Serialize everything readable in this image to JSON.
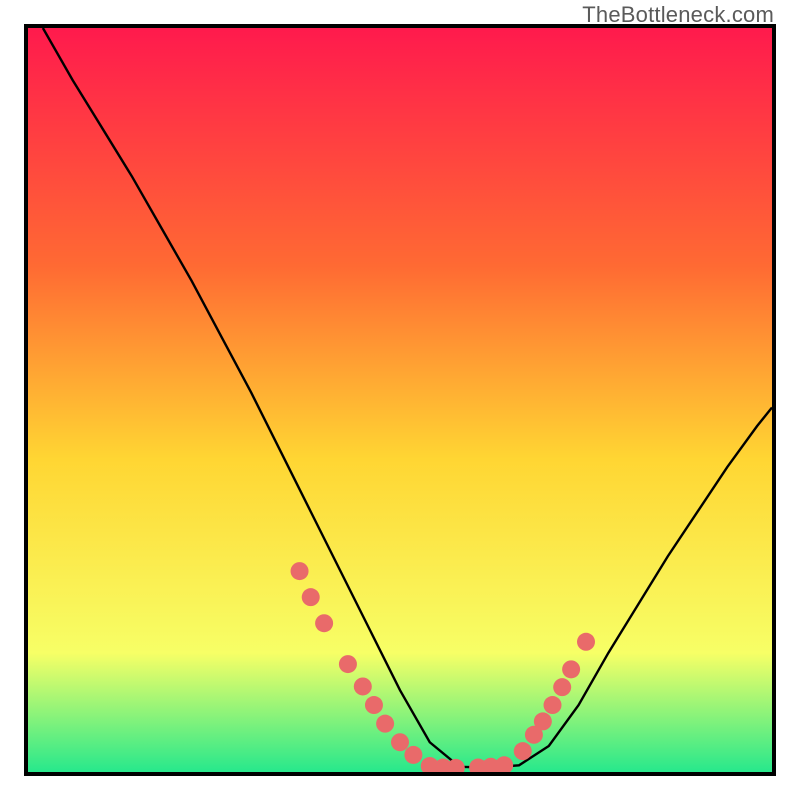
{
  "watermark": "TheBottleneck.com",
  "colors": {
    "border": "#000000",
    "curve": "#000000",
    "marker_fill": "#e96a6a",
    "marker_stroke": "#c94e4e",
    "gradient_top": "#ff1a4d",
    "gradient_mid1": "#ff6a33",
    "gradient_mid2": "#ffd633",
    "gradient_mid3": "#f7ff66",
    "gradient_bottom": "#27e88c"
  },
  "chart_data": {
    "type": "line",
    "title": "",
    "xlabel": "",
    "ylabel": "",
    "xlim": [
      0,
      100
    ],
    "ylim": [
      0,
      100
    ],
    "series": [
      {
        "name": "curve",
        "x": [
          2,
          6,
          10,
          14,
          18,
          22,
          26,
          30,
          34,
          38,
          42,
          46,
          50,
          54,
          58,
          62,
          66,
          70,
          74,
          78,
          82,
          86,
          90,
          94,
          98,
          100
        ],
        "y": [
          100,
          93,
          86.5,
          80,
          73,
          66,
          58.5,
          51,
          43,
          35,
          27,
          19,
          11,
          4,
          0.7,
          0.6,
          0.9,
          3.5,
          9,
          16,
          22.5,
          29,
          35,
          41,
          46.5,
          49
        ]
      }
    ],
    "marker_clusters": [
      {
        "name": "left-descent",
        "points": [
          {
            "x": 36.5,
            "y": 27.0
          },
          {
            "x": 38.0,
            "y": 23.5
          },
          {
            "x": 39.8,
            "y": 20.0
          },
          {
            "x": 43.0,
            "y": 14.5
          },
          {
            "x": 45.0,
            "y": 11.5
          },
          {
            "x": 46.5,
            "y": 9.0
          },
          {
            "x": 48.0,
            "y": 6.5
          },
          {
            "x": 50.0,
            "y": 4.0
          },
          {
            "x": 51.8,
            "y": 2.3
          }
        ]
      },
      {
        "name": "valley-floor",
        "points": [
          {
            "x": 54.0,
            "y": 0.8
          },
          {
            "x": 55.8,
            "y": 0.6
          },
          {
            "x": 57.5,
            "y": 0.55
          },
          {
            "x": 60.5,
            "y": 0.6
          },
          {
            "x": 62.2,
            "y": 0.7
          },
          {
            "x": 64.0,
            "y": 0.9
          }
        ]
      },
      {
        "name": "right-ascent",
        "points": [
          {
            "x": 66.5,
            "y": 2.8
          },
          {
            "x": 68.0,
            "y": 5.0
          },
          {
            "x": 69.2,
            "y": 6.8
          },
          {
            "x": 70.5,
            "y": 9.0
          },
          {
            "x": 71.8,
            "y": 11.4
          },
          {
            "x": 73.0,
            "y": 13.8
          },
          {
            "x": 75.0,
            "y": 17.5
          }
        ]
      }
    ]
  }
}
